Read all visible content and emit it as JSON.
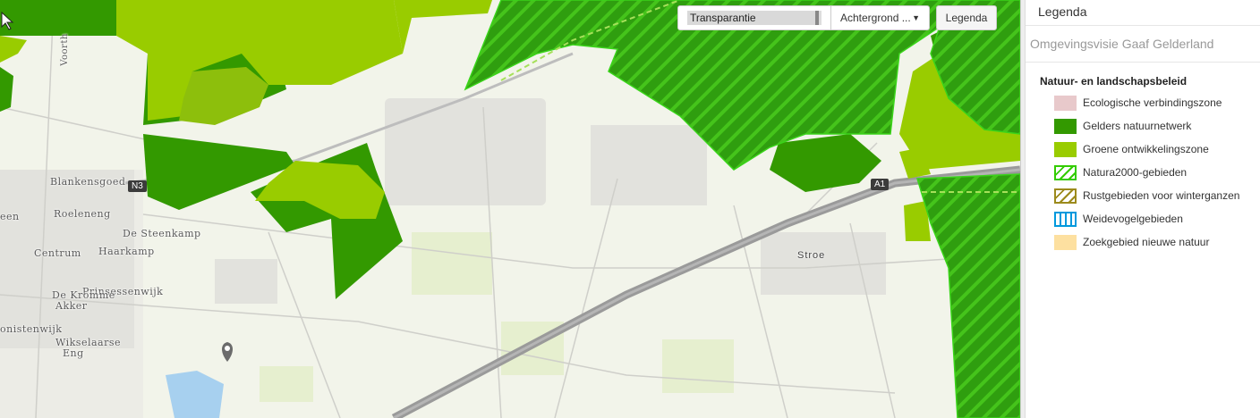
{
  "toolbar": {
    "transparency_label": "Transparantie",
    "transparency_value": 0.97,
    "background_label": "Achtergrond ...",
    "legend_button": "Legenda"
  },
  "panel": {
    "header": "Legenda",
    "service": "Omgevingsvisie Gaaf Gelderland",
    "group": "Natuur- en landschapsbeleid",
    "items": [
      {
        "label": "Ecologische verbindingszone",
        "color": "#e8c9cb",
        "pattern": "solid"
      },
      {
        "label": "Gelders natuurnetwerk",
        "color": "#339900",
        "pattern": "solid"
      },
      {
        "label": "Groene ontwikkelingszone",
        "color": "#99cc00",
        "pattern": "solid"
      },
      {
        "label": "Natura2000-gebieden",
        "color": "#33cc00",
        "pattern": "hatch"
      },
      {
        "label": "Rustgebieden voor winterganzen",
        "color": "#9c8a1c",
        "pattern": "hatch"
      },
      {
        "label": "Weidevogelgebieden",
        "color": "#0099dd",
        "pattern": "vbars"
      },
      {
        "label": "Zoekgebied nieuwe natuur",
        "color": "#fde0a0",
        "pattern": "solid"
      }
    ]
  },
  "map": {
    "places": [
      "Blankensgoed",
      "Roeleneng",
      "De Steenkamp",
      "Centrum",
      "Haarkamp",
      "Prinsessenwijk",
      "De Kromme",
      "Akker",
      "onistenwijk",
      "Wikselaarse",
      "Eng",
      "Stroe",
      "een",
      "Voorth"
    ],
    "roads": [
      "N3",
      "A1"
    ]
  }
}
